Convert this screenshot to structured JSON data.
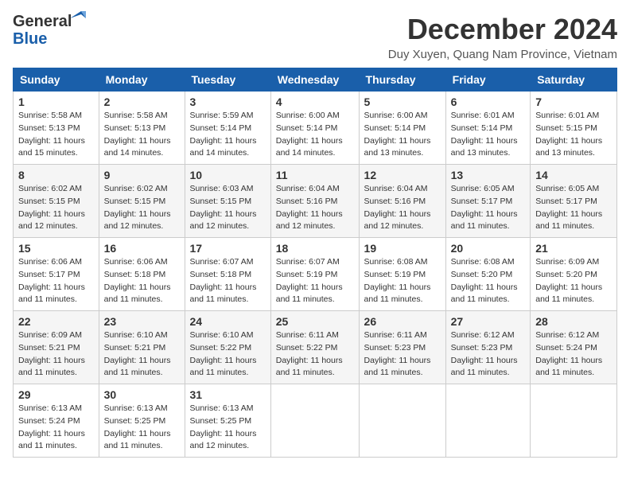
{
  "logo": {
    "general": "General",
    "blue": "Blue"
  },
  "title": {
    "month_year": "December 2024",
    "location": "Duy Xuyen, Quang Nam Province, Vietnam"
  },
  "weekdays": [
    "Sunday",
    "Monday",
    "Tuesday",
    "Wednesday",
    "Thursday",
    "Friday",
    "Saturday"
  ],
  "weeks": [
    [
      {
        "day": "1",
        "sunrise": "5:58 AM",
        "sunset": "5:13 PM",
        "daylight": "11 hours and 15 minutes."
      },
      {
        "day": "2",
        "sunrise": "5:58 AM",
        "sunset": "5:13 PM",
        "daylight": "11 hours and 14 minutes."
      },
      {
        "day": "3",
        "sunrise": "5:59 AM",
        "sunset": "5:14 PM",
        "daylight": "11 hours and 14 minutes."
      },
      {
        "day": "4",
        "sunrise": "6:00 AM",
        "sunset": "5:14 PM",
        "daylight": "11 hours and 14 minutes."
      },
      {
        "day": "5",
        "sunrise": "6:00 AM",
        "sunset": "5:14 PM",
        "daylight": "11 hours and 13 minutes."
      },
      {
        "day": "6",
        "sunrise": "6:01 AM",
        "sunset": "5:14 PM",
        "daylight": "11 hours and 13 minutes."
      },
      {
        "day": "7",
        "sunrise": "6:01 AM",
        "sunset": "5:15 PM",
        "daylight": "11 hours and 13 minutes."
      }
    ],
    [
      {
        "day": "8",
        "sunrise": "6:02 AM",
        "sunset": "5:15 PM",
        "daylight": "11 hours and 12 minutes."
      },
      {
        "day": "9",
        "sunrise": "6:02 AM",
        "sunset": "5:15 PM",
        "daylight": "11 hours and 12 minutes."
      },
      {
        "day": "10",
        "sunrise": "6:03 AM",
        "sunset": "5:15 PM",
        "daylight": "11 hours and 12 minutes."
      },
      {
        "day": "11",
        "sunrise": "6:04 AM",
        "sunset": "5:16 PM",
        "daylight": "11 hours and 12 minutes."
      },
      {
        "day": "12",
        "sunrise": "6:04 AM",
        "sunset": "5:16 PM",
        "daylight": "11 hours and 12 minutes."
      },
      {
        "day": "13",
        "sunrise": "6:05 AM",
        "sunset": "5:17 PM",
        "daylight": "11 hours and 11 minutes."
      },
      {
        "day": "14",
        "sunrise": "6:05 AM",
        "sunset": "5:17 PM",
        "daylight": "11 hours and 11 minutes."
      }
    ],
    [
      {
        "day": "15",
        "sunrise": "6:06 AM",
        "sunset": "5:17 PM",
        "daylight": "11 hours and 11 minutes."
      },
      {
        "day": "16",
        "sunrise": "6:06 AM",
        "sunset": "5:18 PM",
        "daylight": "11 hours and 11 minutes."
      },
      {
        "day": "17",
        "sunrise": "6:07 AM",
        "sunset": "5:18 PM",
        "daylight": "11 hours and 11 minutes."
      },
      {
        "day": "18",
        "sunrise": "6:07 AM",
        "sunset": "5:19 PM",
        "daylight": "11 hours and 11 minutes."
      },
      {
        "day": "19",
        "sunrise": "6:08 AM",
        "sunset": "5:19 PM",
        "daylight": "11 hours and 11 minutes."
      },
      {
        "day": "20",
        "sunrise": "6:08 AM",
        "sunset": "5:20 PM",
        "daylight": "11 hours and 11 minutes."
      },
      {
        "day": "21",
        "sunrise": "6:09 AM",
        "sunset": "5:20 PM",
        "daylight": "11 hours and 11 minutes."
      }
    ],
    [
      {
        "day": "22",
        "sunrise": "6:09 AM",
        "sunset": "5:21 PM",
        "daylight": "11 hours and 11 minutes."
      },
      {
        "day": "23",
        "sunrise": "6:10 AM",
        "sunset": "5:21 PM",
        "daylight": "11 hours and 11 minutes."
      },
      {
        "day": "24",
        "sunrise": "6:10 AM",
        "sunset": "5:22 PM",
        "daylight": "11 hours and 11 minutes."
      },
      {
        "day": "25",
        "sunrise": "6:11 AM",
        "sunset": "5:22 PM",
        "daylight": "11 hours and 11 minutes."
      },
      {
        "day": "26",
        "sunrise": "6:11 AM",
        "sunset": "5:23 PM",
        "daylight": "11 hours and 11 minutes."
      },
      {
        "day": "27",
        "sunrise": "6:12 AM",
        "sunset": "5:23 PM",
        "daylight": "11 hours and 11 minutes."
      },
      {
        "day": "28",
        "sunrise": "6:12 AM",
        "sunset": "5:24 PM",
        "daylight": "11 hours and 11 minutes."
      }
    ],
    [
      {
        "day": "29",
        "sunrise": "6:13 AM",
        "sunset": "5:24 PM",
        "daylight": "11 hours and 11 minutes."
      },
      {
        "day": "30",
        "sunrise": "6:13 AM",
        "sunset": "5:25 PM",
        "daylight": "11 hours and 11 minutes."
      },
      {
        "day": "31",
        "sunrise": "6:13 AM",
        "sunset": "5:25 PM",
        "daylight": "11 hours and 12 minutes."
      },
      null,
      null,
      null,
      null
    ]
  ],
  "labels": {
    "sunrise": "Sunrise:",
    "sunset": "Sunset:",
    "daylight": "Daylight:"
  }
}
